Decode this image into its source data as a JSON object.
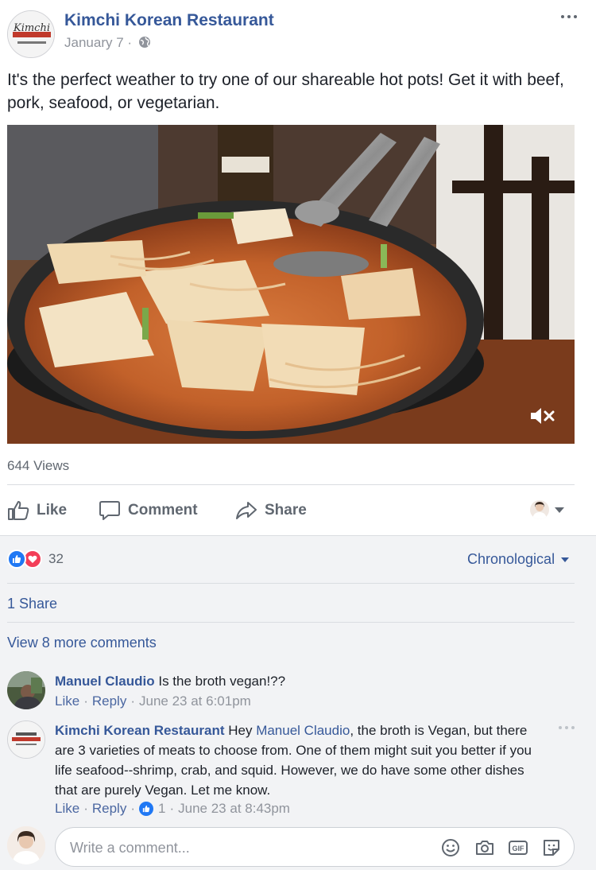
{
  "post": {
    "page_name": "Kimchi Korean Restaurant",
    "date": "January 7",
    "date_separator": "·",
    "text": "It's the perfect weather to try one of our shareable hot pots! Get it with beef, pork, seafood, or vegetarian.",
    "views": "644 Views",
    "logo_text": "Kimchi"
  },
  "actions": {
    "like": "Like",
    "comment": "Comment",
    "share": "Share"
  },
  "feedback": {
    "reaction_count": "32",
    "order": "Chronological",
    "shares": "1 Share",
    "view_more": "View 8 more comments"
  },
  "comments": [
    {
      "author": "Manuel Claudio",
      "text": " Is the broth vegan!??",
      "like": "Like",
      "reply": "Reply",
      "time": "June 23 at 6:01pm"
    },
    {
      "author": "Kimchi Korean Restaurant",
      "text_before": " Hey ",
      "mention": "Manuel Claudio",
      "text_after": ", the broth is Vegan, but there are 3 varieties of meats to choose from. One of them might suit you better if you life seafood--shrimp, crab, and squid. However, we do have some other dishes that are purely Vegan. Let me know.",
      "like": "Like",
      "reply": "Reply",
      "like_count": "1",
      "time": "June 23 at 8:43pm"
    }
  ],
  "composer": {
    "placeholder": "Write a comment...",
    "gif_label": "GIF"
  },
  "colors": {
    "link": "#365899",
    "like_blue": "#2078f4",
    "love_red": "#f33e58",
    "muted": "#606770",
    "comments_bg": "#f2f3f5"
  },
  "icons": [
    "globe-icon",
    "more-icon",
    "mute-icon",
    "thumbs-up-icon",
    "comment-bubble-icon",
    "share-arrow-icon",
    "emoji-icon",
    "camera-icon",
    "gif-icon",
    "sticker-icon"
  ]
}
